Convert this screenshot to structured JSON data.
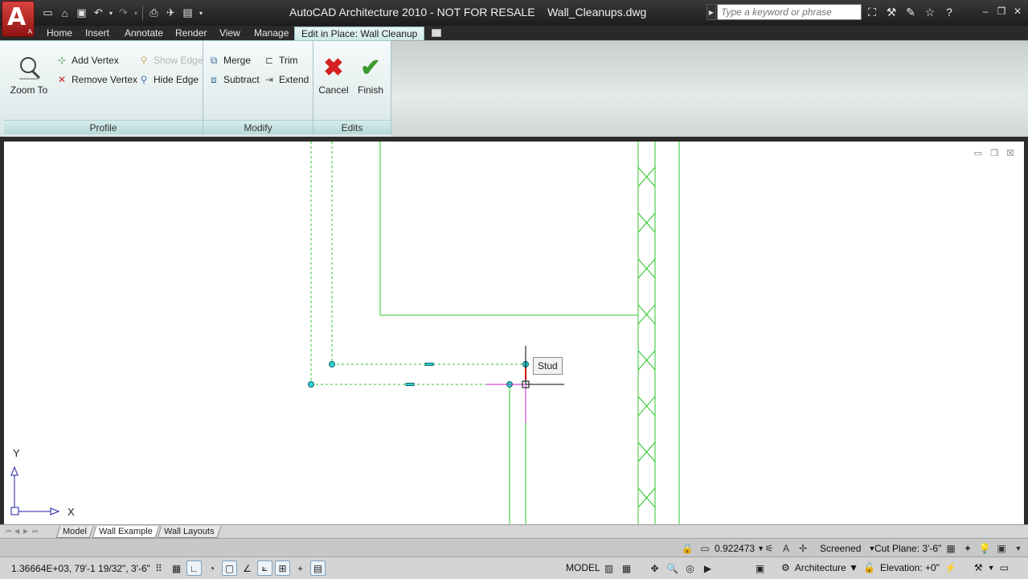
{
  "titlebar": {
    "app_letter": "A",
    "title": "AutoCAD Architecture 2010 - NOT FOR RESALE    Wall_Cleanups.dwg",
    "search_placeholder": "Type a keyword or phrase",
    "quick_access_icons": [
      "new-icon",
      "open-icon",
      "save-icon",
      "undo-icon",
      "redo-icon",
      "plot-icon",
      "publish-icon",
      "workspace-icon"
    ]
  },
  "ribbon_tabs": [
    {
      "label": "Home"
    },
    {
      "label": "Insert"
    },
    {
      "label": "Annotate"
    },
    {
      "label": "Render"
    },
    {
      "label": "View"
    },
    {
      "label": "Manage"
    },
    {
      "label": "Edit in Place: Wall Cleanup",
      "active": true
    }
  ],
  "ribbon": {
    "profile": {
      "title": "Profile",
      "zoom_to": "Zoom To",
      "add_vertex": "Add Vertex",
      "remove_vertex": "Remove Vertex",
      "show_edge": "Show Edge",
      "hide_edge": "Hide Edge"
    },
    "modify": {
      "title": "Modify",
      "merge": "Merge",
      "trim": "Trim",
      "subtract": "Subtract",
      "extend": "Extend"
    },
    "edits": {
      "title": "Edits",
      "cancel": "Cancel",
      "finish": "Finish"
    }
  },
  "drawing": {
    "tooltip": "Stud",
    "ucs_y": "Y",
    "ucs_x": "X",
    "colors": {
      "wall": "#2ec62e",
      "grip": "#2fd0d0",
      "crosshair": "#000000"
    }
  },
  "layout_tabs": [
    {
      "label": "Model"
    },
    {
      "label": "Wall Example",
      "active": true
    },
    {
      "label": "Wall Layouts"
    }
  ],
  "drawing_status": {
    "scale": "0.922473",
    "display": "Screened",
    "cut_plane": "Cut Plane:  3'-6\""
  },
  "status": {
    "coordinates": "1.36664E+03,  79'-1 19/32\", 3'-6\"",
    "model": "MODEL",
    "workspace": "Architecture",
    "elevation": "Elevation: +0\""
  }
}
